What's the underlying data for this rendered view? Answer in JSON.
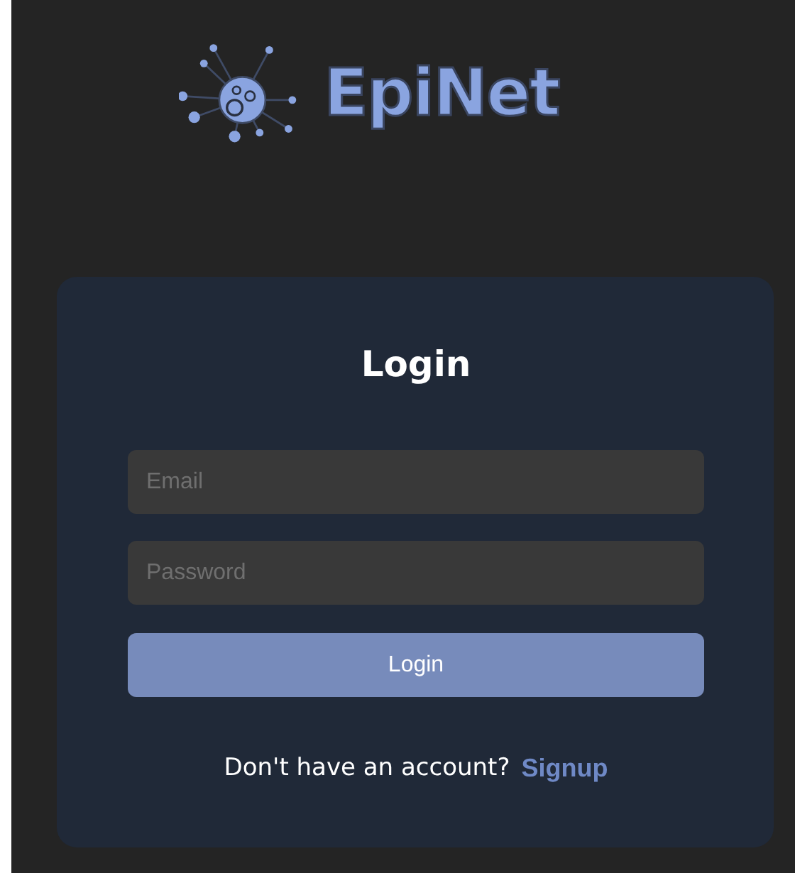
{
  "logo": {
    "text": "EpiNet"
  },
  "form": {
    "title": "Login",
    "fields": [
      {
        "placeholder": "Email"
      },
      {
        "placeholder": "Password"
      }
    ],
    "submit": "Login",
    "footer": {
      "text": "Don't have an account?",
      "link": "Signup"
    }
  }
}
